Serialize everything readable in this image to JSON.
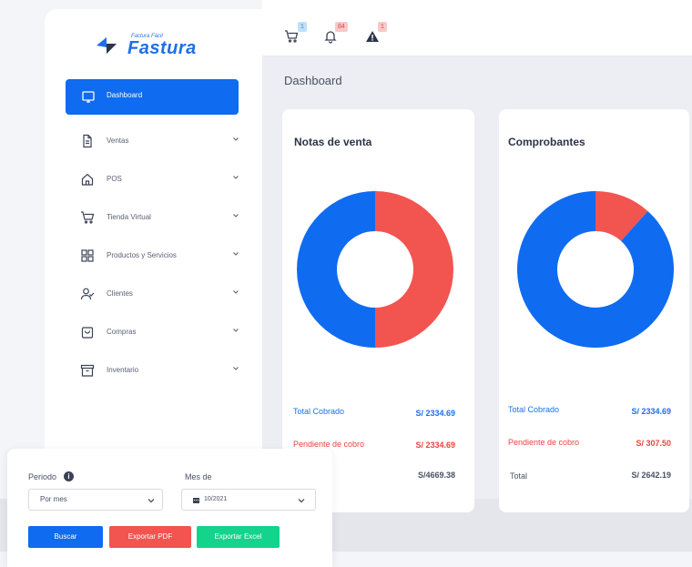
{
  "topbar": {
    "cart_badge": "1",
    "bell_badge": "84",
    "alert_badge": "1",
    "icons": [
      "cart-icon",
      "bell-icon",
      "warning-icon"
    ]
  },
  "page_title": "Dashboard",
  "logo": {
    "small": "Factura Fácil",
    "big": "Fastura"
  },
  "sidebar": {
    "active": {
      "label": "Dashboard",
      "icon": "monitor-icon"
    },
    "items": [
      {
        "label": "Ventas",
        "icon": "document-icon"
      },
      {
        "label": "POS",
        "icon": "home-icon"
      },
      {
        "label": "Tienda Virtual",
        "icon": "cart-icon"
      },
      {
        "label": "Productos y Servicios",
        "icon": "grid-icon"
      },
      {
        "label": "Clientes",
        "icon": "user-check-icon"
      },
      {
        "label": "Compras",
        "icon": "bag-icon"
      },
      {
        "label": "Inventario",
        "icon": "archive-icon"
      }
    ]
  },
  "cards": [
    {
      "title": "Notas de venta",
      "rows": [
        {
          "label": "Total Cobrado",
          "value": "S/ 2334.69"
        },
        {
          "label": "Pendiente de cobro",
          "value": "S/ 2334.69"
        },
        {
          "label": "",
          "value": "S/4669.38"
        }
      ]
    },
    {
      "title": "Comprobantes",
      "rows": [
        {
          "label": "Total Cobrado",
          "value": "S/ 2334.69"
        },
        {
          "label": "Pendiente de cobro",
          "value": "S/ 307.50"
        },
        {
          "label": "Total",
          "value": "S/ 2642.19"
        }
      ]
    }
  ],
  "chart_data": [
    {
      "type": "pie",
      "labels": [
        "Total Cobrado",
        "Pendiente de cobro"
      ],
      "values": [
        2334.69,
        2334.69
      ],
      "colors": [
        "#0f6bf0",
        "#f25450"
      ]
    },
    {
      "type": "pie",
      "labels": [
        "Total Cobrado",
        "Pendiente de cobro"
      ],
      "values": [
        2334.69,
        307.5
      ],
      "colors": [
        "#0f6bf0",
        "#f25450"
      ]
    }
  ],
  "filter": {
    "periodo_label": "Periodo",
    "periodo_value": "Por mes",
    "mes_label": "Mes de",
    "mes_value": "10/2021",
    "buscar": "Buscar",
    "export_pdf": "Exportar PDF",
    "export_excel": "Exportar Excel"
  },
  "colors": {
    "primary": "#0f6bf0",
    "danger": "#f25450",
    "success": "#14d38a"
  }
}
